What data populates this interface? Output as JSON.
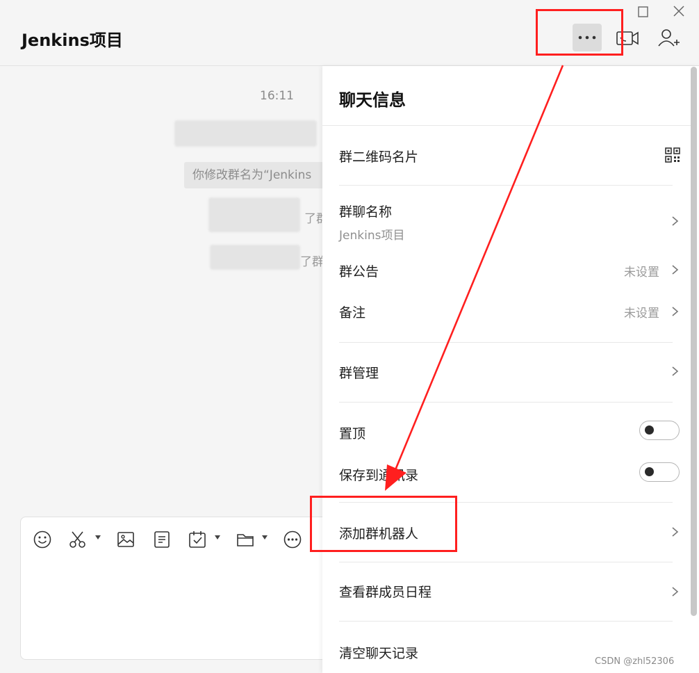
{
  "header": {
    "title": "Jenkins项目"
  },
  "chat": {
    "timestamp": "16:11",
    "system_message": "你修改群名为“Jenkins",
    "fragments": [
      "了群",
      "了群"
    ]
  },
  "composer": {
    "tools": [
      "emoji-icon",
      "scissors-icon",
      "image-icon",
      "document-icon",
      "calendar-check-icon",
      "folder-icon",
      "more-circle-icon"
    ]
  },
  "panel": {
    "title": "聊天信息",
    "qr_label": "群二维码名片",
    "group_name_label": "群聊名称",
    "group_name_value": "Jenkins项目",
    "announcement_label": "群公告",
    "announcement_value": "未设置",
    "remark_label": "备注",
    "remark_value": "未设置",
    "manage_label": "群管理",
    "pin_label": "置顶",
    "pin_on": false,
    "save_contacts_label": "保存到通讯录",
    "save_contacts_on": false,
    "add_robot_label": "添加群机器人",
    "member_schedule_label": "查看群成员日程",
    "clear_history_label": "清空聊天记录"
  },
  "colors": {
    "annotation": "#ff1f1f",
    "panel_bg": "#ffffff",
    "chat_bg": "#f5f5f5"
  },
  "watermark": "CSDN @zhl52306"
}
